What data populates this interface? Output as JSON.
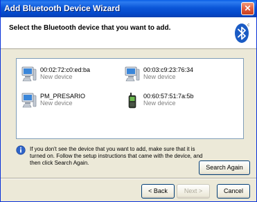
{
  "window": {
    "title": "Add Bluetooth Device Wizard",
    "close_glyph": "✕"
  },
  "header": {
    "title": "Select the Bluetooth device that you want to add.",
    "logo_icon": "bluetooth-logo-icon"
  },
  "devices": [
    {
      "name": "00:02:72:c0:ed:ba",
      "status": "New device",
      "icon": "computer-icon"
    },
    {
      "name": "00:03:c9:23:76:34",
      "status": "New device",
      "icon": "computer-icon"
    },
    {
      "name": "PM_PRESARIO",
      "status": "New device",
      "icon": "computer-icon"
    },
    {
      "name": "00:60:57:51:7a:5b",
      "status": "New device",
      "icon": "mobile-phone-icon"
    }
  ],
  "info": {
    "text": "If you don't see the device that you want to add, make sure that it is turned on. Follow the setup instructions that came with the device, and then click Search Again.",
    "icon": "info-icon"
  },
  "buttons": {
    "search_again": "Search Again",
    "back": "< Back",
    "next": "Next >",
    "cancel": "Cancel"
  },
  "colors": {
    "title_bar": "#0b56d8",
    "dialog_bg": "#ece9d8",
    "close": "#e0573a",
    "bluetooth": "#1a5bc4"
  }
}
